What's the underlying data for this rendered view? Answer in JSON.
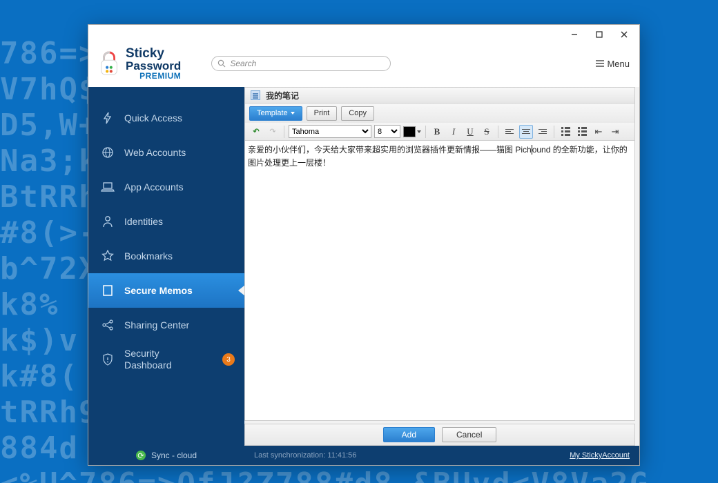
{
  "app": {
    "brand_line1": "Sticky",
    "brand_line2": "Password",
    "brand_line3": "PREMIUM"
  },
  "header": {
    "search_placeholder": "Search",
    "menu_label": "Menu"
  },
  "sidebar": {
    "items": [
      {
        "label": "Quick Access"
      },
      {
        "label": "Web Accounts"
      },
      {
        "label": "App Accounts"
      },
      {
        "label": "Identities"
      },
      {
        "label": "Bookmarks"
      },
      {
        "label": "Secure Memos"
      },
      {
        "label": "Sharing Center"
      },
      {
        "label": "Security Dashboard",
        "badge": "3"
      }
    ],
    "sync_label": "Sync - cloud"
  },
  "memo": {
    "title": "我的笔记",
    "toolbar": {
      "template_label": "Template",
      "print_label": "Print",
      "copy_label": "Copy"
    },
    "font": "Tahoma",
    "font_size": "8",
    "body_before_cursor": "亲爱的小伙伴们，今天给大家带来超实用的浏览器插件更新情报——猫图 Pich",
    "body_after_cursor": "ound 的全新功能，让你的图片处理更上一层楼！"
  },
  "footer": {
    "add_label": "Add",
    "cancel_label": "Cancel"
  },
  "status": {
    "last_sync": "Last synchronization: 11:41:56",
    "account_link": "My StickyAccount"
  }
}
